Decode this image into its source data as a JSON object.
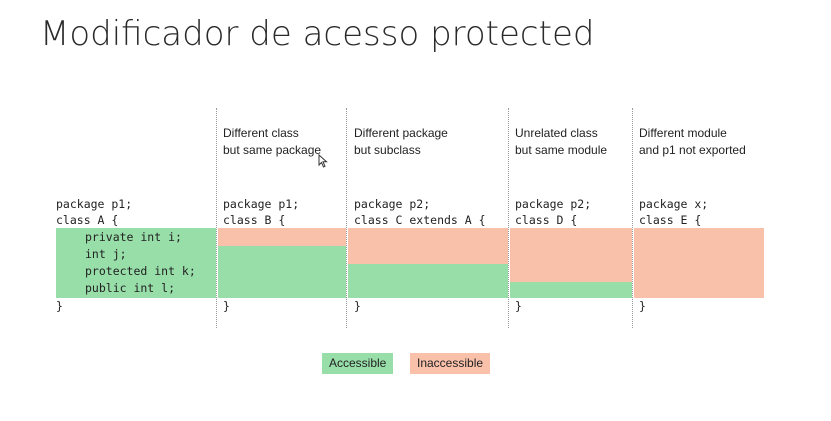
{
  "title": "Modificador de acesso protected",
  "headers": [
    [
      "Different class",
      "but same package"
    ],
    [
      "Different package",
      "but subclass"
    ],
    [
      "Unrelated class",
      "but same module"
    ],
    [
      "Different module",
      "and p1 not exported"
    ]
  ],
  "classA": {
    "package": "package p1;",
    "decl": "class A {",
    "fields": [
      "private int i;",
      "int j;",
      "protected int k;",
      "public int l;"
    ],
    "close": "}"
  },
  "columns": [
    {
      "package": "package p1;",
      "decl": "class B {",
      "close": "}"
    },
    {
      "package": "package p2;",
      "decl": "class C extends A {",
      "close": "}"
    },
    {
      "package": "package p2;",
      "decl": "class D {",
      "close": "}"
    },
    {
      "package": "package x;",
      "decl": "class E {",
      "close": "}"
    }
  ],
  "access": {
    "B": [
      "Inaccessible",
      "Accessible",
      "Accessible",
      "Accessible"
    ],
    "C": [
      "Inaccessible",
      "Inaccessible",
      "Accessible",
      "Accessible"
    ],
    "D": [
      "Inaccessible",
      "Inaccessible",
      "Inaccessible",
      "Accessible"
    ],
    "E": [
      "Inaccessible",
      "Inaccessible",
      "Inaccessible",
      "Inaccessible"
    ]
  },
  "legend": {
    "accessible": "Accessible",
    "inaccessible": "Inaccessible"
  },
  "colors": {
    "accessible": "#98dea9",
    "inaccessible": "#f9c0aa"
  }
}
